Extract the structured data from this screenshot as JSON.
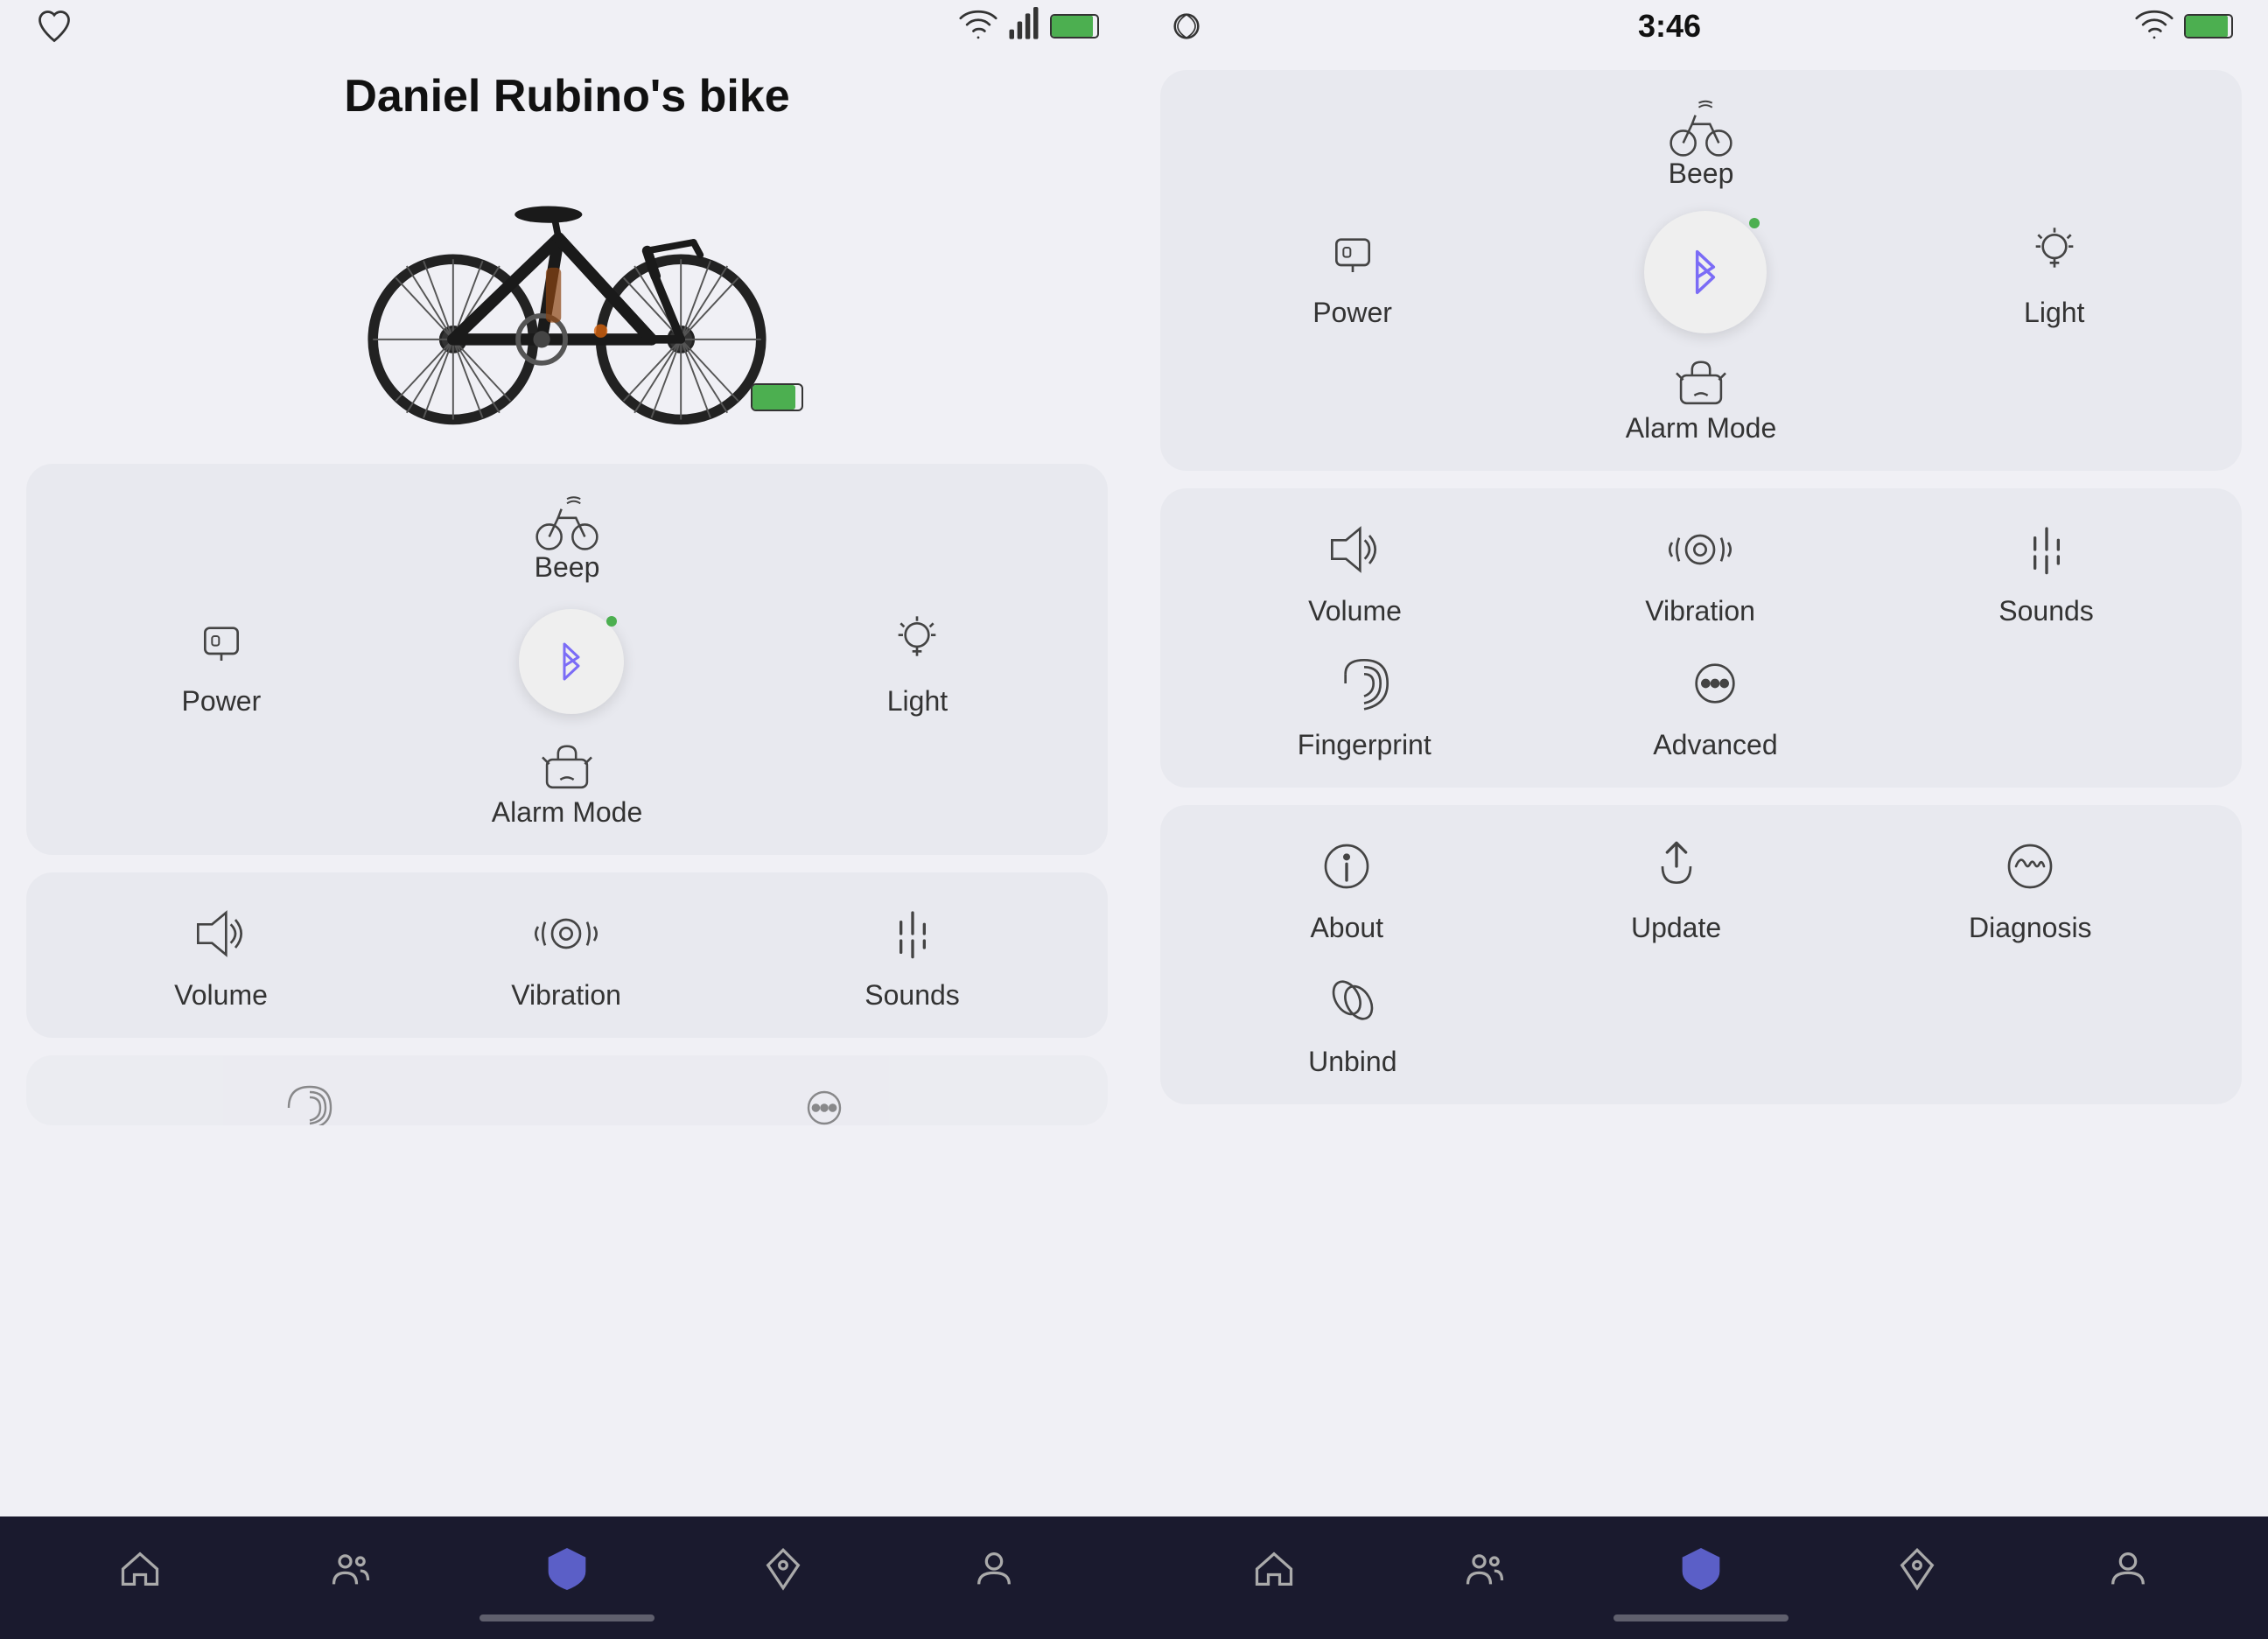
{
  "left": {
    "statusBar": {
      "heartIcon": "heart-icon",
      "wifiIcon": "wifi-icon",
      "batteryIcon": "battery-icon"
    },
    "bikeSection": {
      "title": "Daniel Rubino's bike"
    },
    "card1": {
      "beep": {
        "label": "Beep"
      },
      "power": {
        "label": "Power"
      },
      "bluetooth": {
        "label": ""
      },
      "light": {
        "label": "Light"
      },
      "alarmMode": {
        "label": "Alarm Mode"
      }
    },
    "card2": {
      "volume": {
        "label": "Volume"
      },
      "vibration": {
        "label": "Vibration"
      },
      "sounds": {
        "label": "Sounds"
      }
    },
    "bottomNav": {
      "home": "home-nav",
      "people": "people-nav",
      "shield": "shield-nav",
      "location": "location-nav",
      "profile": "profile-nav"
    }
  },
  "right": {
    "statusBar": {
      "time": "3:46",
      "connected": "connected-icon",
      "battery": "battery-full-icon"
    },
    "card1": {
      "beep": {
        "label": "Beep"
      },
      "power": {
        "label": "Power"
      },
      "bluetooth": {
        "label": ""
      },
      "light": {
        "label": "Light"
      },
      "alarmMode": {
        "label": "Alarm Mode"
      }
    },
    "card2": {
      "volume": {
        "label": "Volume"
      },
      "vibration": {
        "label": "Vibration"
      },
      "sounds": {
        "label": "Sounds"
      },
      "fingerprint": {
        "label": "Fingerprint"
      },
      "advanced": {
        "label": "Advanced"
      }
    },
    "card3": {
      "about": {
        "label": "About"
      },
      "update": {
        "label": "Update"
      },
      "diagnosis": {
        "label": "Diagnosis"
      },
      "unbind": {
        "label": "Unbind"
      }
    },
    "bottomNav": {
      "home": "home-nav",
      "people": "people-nav",
      "shield": "shield-nav",
      "location": "location-nav",
      "profile": "profile-nav"
    }
  }
}
